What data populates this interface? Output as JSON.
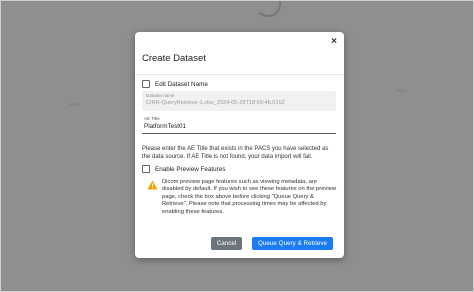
{
  "dialog": {
    "title": "Create Dataset",
    "close_symbol": "×"
  },
  "edit_dataset_name": {
    "label": "Edit Dataset Name",
    "checked": false
  },
  "dataset_name": {
    "label": "Dataset name",
    "value": "CIRR-QueryRetrieve-1.xlsx_2024-05-29T18:59:46.016Z",
    "disabled": true
  },
  "ae_title": {
    "label": "AE Title",
    "value": "PlatformTest01"
  },
  "help_text": "Please enter the AE Title that exists in the PACS you have selected as the data source. If AE Title is not found, your data import will fail.",
  "enable_preview": {
    "label": "Enable Preview Features",
    "checked": false
  },
  "warning": {
    "icon": "warning-triangle-icon",
    "text": "Dicom preview page features such as viewing metadata, are disabled by default. If you wish to see these features on the preview page, check the box above before clicking \"Queue Query & Retrieve\". Please note that processing times may be affected by enabling these features."
  },
  "buttons": {
    "cancel": "Cancel",
    "submit": "Queue Query & Retrieve"
  },
  "colors": {
    "overlay": "#8f8f8f",
    "primary": "#1a7bf2",
    "secondary": "#6c757d",
    "warning": "#f0a500"
  }
}
